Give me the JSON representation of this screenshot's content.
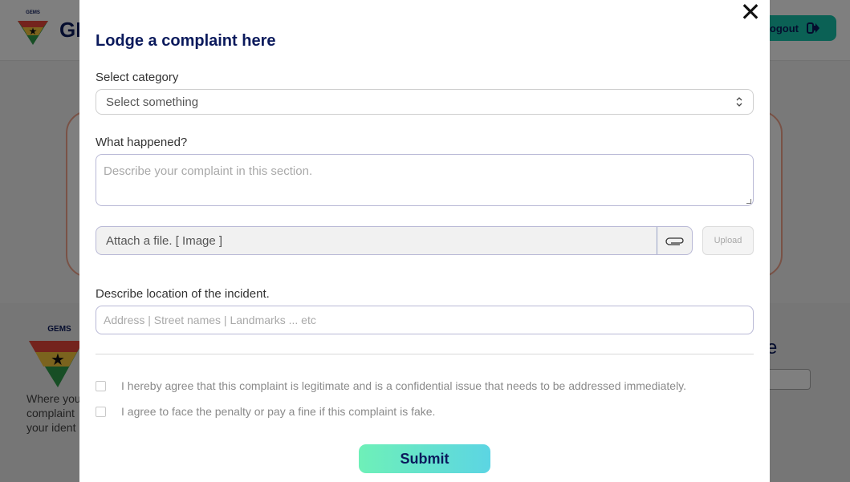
{
  "background": {
    "brand_partial": "GE",
    "logo_text": "GEMS",
    "logout_label": "Logout",
    "footer_text_lines": [
      "Where you",
      "complaint",
      "your ident"
    ],
    "footer_heading_partial": "e",
    "colors": {
      "navy": "#0b1a5c",
      "teal": "#16c3aa"
    }
  },
  "modal": {
    "title": "Lodge a complaint here",
    "category": {
      "label": "Select category",
      "selected": "Select something"
    },
    "what_happened": {
      "label": "What happened?",
      "placeholder": "Describe your complaint in this section."
    },
    "attachment": {
      "text": "Attach a file. [ Image ]",
      "icon": "paperclip-icon",
      "upload_label": "Upload"
    },
    "location": {
      "label": "Describe location of the incident.",
      "placeholder": "Address | Street names | Landmarks ... etc"
    },
    "agreements": [
      "I hereby agree that this complaint is legitimate and is a confidential issue that needs to be addressed immediately.",
      "I agree to face the penalty or pay a fine if this complaint is fake."
    ],
    "submit_label": "Submit",
    "close_icon": "close-icon",
    "close_glyph": "✕"
  }
}
